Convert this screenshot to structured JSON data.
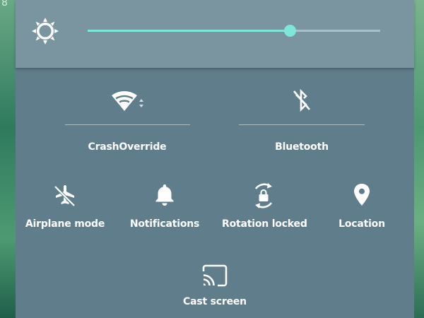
{
  "wallpaper": {
    "glyph": "8"
  },
  "brightness": {
    "level_fraction": 0.69,
    "icon": "sun-icon",
    "accent": "#80e6dc"
  },
  "tiles_large": [
    {
      "label": "CrashOverride",
      "icon": "wifi-icon"
    },
    {
      "label": "Bluetooth",
      "icon": "bluetooth-disabled-icon"
    }
  ],
  "tiles_small": [
    {
      "label": "Airplane mode",
      "icon": "airplane-off-icon"
    },
    {
      "label": "Notifications",
      "icon": "bell-icon"
    },
    {
      "label": "Rotation locked",
      "icon": "rotation-lock-icon"
    },
    {
      "label": "Location",
      "icon": "location-pin-icon"
    }
  ],
  "tile_bottom": {
    "label": "Cast screen",
    "icon": "cast-icon"
  },
  "colors": {
    "panel": "#607d8b",
    "brightness_bar": "#7a959f"
  }
}
